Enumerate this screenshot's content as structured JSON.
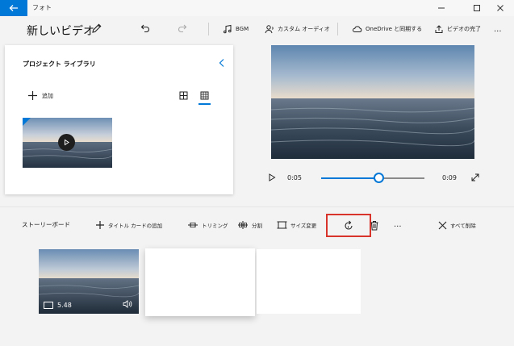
{
  "app": {
    "title": "フォト",
    "accent": "#0078d7"
  },
  "icons": {
    "back": "back-arrow-icon",
    "minimize": "minimize-icon",
    "maximize": "maximize-icon",
    "close": "close-icon",
    "edit": "pencil-icon",
    "undo": "undo-icon",
    "redo": "redo-icon",
    "bgm": "music-note-icon",
    "custom_audio": "person-audio-icon",
    "onedrive": "cloud-sync-icon",
    "export": "export-icon",
    "add": "plus-icon",
    "grid_small": "grid-small-icon",
    "grid_large": "grid-large-icon",
    "collapse": "chevron-left-icon",
    "play": "play-icon",
    "fullscreen": "expand-icon",
    "trim": "trim-icon",
    "split": "split-icon",
    "resize": "resize-icon",
    "rotate": "rotate-icon",
    "delete": "trash-icon",
    "more": "more-icon",
    "remove_all": "x-icon",
    "duration": "clip-icon",
    "volume": "speaker-icon"
  },
  "toolbar": {
    "video_title": "新しいビデオ",
    "bgm_label": "BGM",
    "custom_audio_label": "カスタム オーディオ",
    "onedrive_label": "OneDrive と同期する",
    "export_label": "ビデオの完了",
    "more_label": "..."
  },
  "library": {
    "title": "プロジェクト ライブラリ",
    "add_label": "追加"
  },
  "player": {
    "current_time": "0:05",
    "end_time": "0:09",
    "progress": 0.56
  },
  "storyboard": {
    "title": "ストーリーボード",
    "add_title_card": "タイトル カードの追加",
    "trim": "トリミング",
    "split": "分割",
    "resize": "サイズ変更",
    "more_label": "...",
    "remove_all": "すべて削除",
    "clips": [
      {
        "duration": "5.48"
      }
    ]
  }
}
